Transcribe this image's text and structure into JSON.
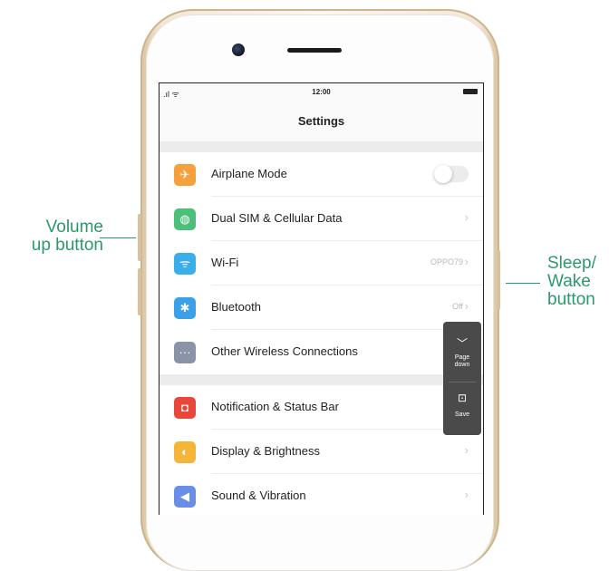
{
  "annotations": {
    "left": {
      "line1": "Volume",
      "line2": "up button"
    },
    "right": {
      "line1": "Sleep/",
      "line2": "Wake",
      "line3": "button"
    }
  },
  "status_bar": {
    "time": "12:00"
  },
  "screen": {
    "title": "Settings"
  },
  "settings_groups": [
    [
      {
        "label": "Airplane Mode",
        "icon": "airplane-icon",
        "icon_color": "#f5a03a",
        "control": "toggle"
      },
      {
        "label": "Dual SIM & Cellular Data",
        "icon": "globe-icon",
        "icon_color": "#4cc07a",
        "control": "chevron"
      },
      {
        "label": "Wi-Fi",
        "icon": "wifi-icon",
        "icon_color": "#3aaee8",
        "value": "OPPO79",
        "control": "chevron"
      },
      {
        "label": "Bluetooth",
        "icon": "bluetooth-icon",
        "icon_color": "#3aa0e8",
        "value": "Off",
        "control": "chevron"
      },
      {
        "label": "Other Wireless Connections",
        "icon": "more-icon",
        "icon_color": "#8a93a8",
        "control": "chevron"
      }
    ],
    [
      {
        "label": "Notification & Status Bar",
        "icon": "notification-icon",
        "icon_color": "#e8473c",
        "control": "chevron"
      },
      {
        "label": "Display & Brightness",
        "icon": "brightness-icon",
        "icon_color": "#f5b53a",
        "control": "chevron"
      },
      {
        "label": "Sound & Vibration",
        "icon": "sound-icon",
        "icon_color": "#6a8ee8",
        "control": "chevron"
      }
    ]
  ],
  "floating_panel": {
    "page_down": {
      "line1": "Page",
      "line2": "down"
    },
    "save": "Save"
  }
}
